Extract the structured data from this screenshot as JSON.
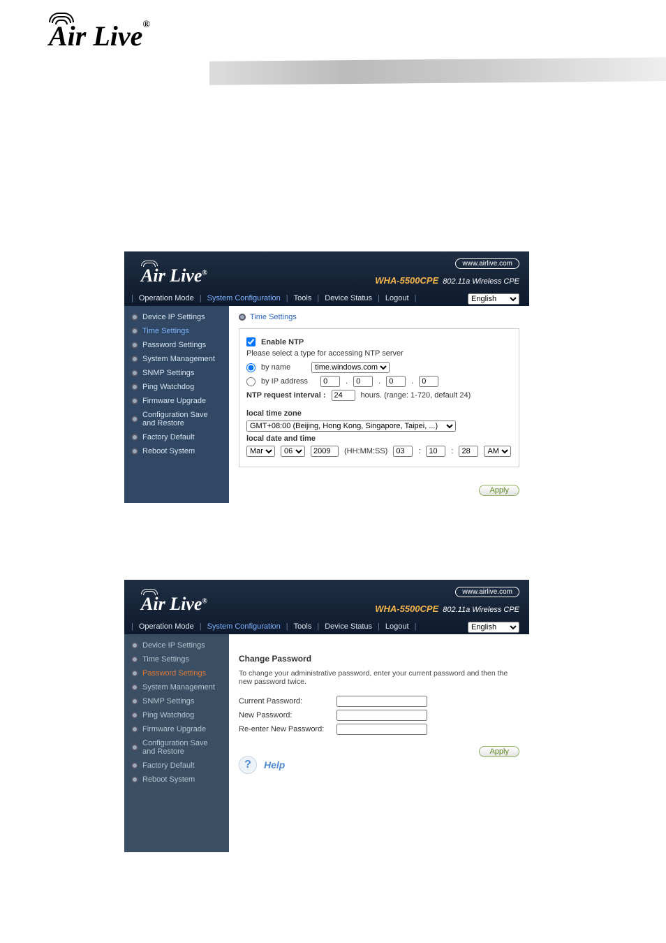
{
  "page_logo": "Air Live",
  "logo_reg": "®",
  "router": {
    "url_badge": "www.airlive.com",
    "model": "WHA-5500CPE",
    "model_desc": "802.11a Wireless CPE",
    "tabs": [
      "Operation Mode",
      "System Configuration",
      "Tools",
      "Device Status",
      "Logout"
    ],
    "active_tab": "System Configuration",
    "lang": "English",
    "sidebar": [
      "Device IP Settings",
      "Time Settings",
      "Password Settings",
      "System Management",
      "SNMP Settings",
      "Ping Watchdog",
      "Firmware Upgrade",
      "Configuration Save and Restore",
      "Factory Default",
      "Reboot System"
    ]
  },
  "shot1": {
    "active_side": "Time Settings",
    "section_title": "Time Settings",
    "enable_ntp_label": "Enable NTP",
    "enable_ntp_checked": true,
    "ntp_desc": "Please select a type for accessing NTP server",
    "by_name_label": "by name",
    "by_ip_label": "by IP address",
    "ntp_server_name": "time.windows.com",
    "ip": [
      "0",
      "0",
      "0",
      "0"
    ],
    "ntp_req_lbl": "NTP request interval :",
    "ntp_req_val": "24",
    "ntp_req_suffix": "hours. (range: 1-720, default 24)",
    "ltz_lbl": "local time zone",
    "ltz_val": "GMT+08:00 (Beijing, Hong Kong, Singapore, Taipei, ...)",
    "ldt_lbl": "local date and time",
    "month": "Mar",
    "day": "06",
    "year": "2009",
    "hhmmss_lbl": "(HH:MM:SS)",
    "hh": "03",
    "mm": "10",
    "ss": "28",
    "ampm": "AM",
    "apply": "Apply"
  },
  "shot2": {
    "active_side": "Password Settings",
    "title": "Change Password",
    "desc": "To change your administrative password, enter your current password and then the new password twice.",
    "cur_lbl": "Current Password:",
    "new_lbl": "New Password:",
    "re_lbl": "Re-enter New Password:",
    "apply": "Apply",
    "help": "Help"
  }
}
